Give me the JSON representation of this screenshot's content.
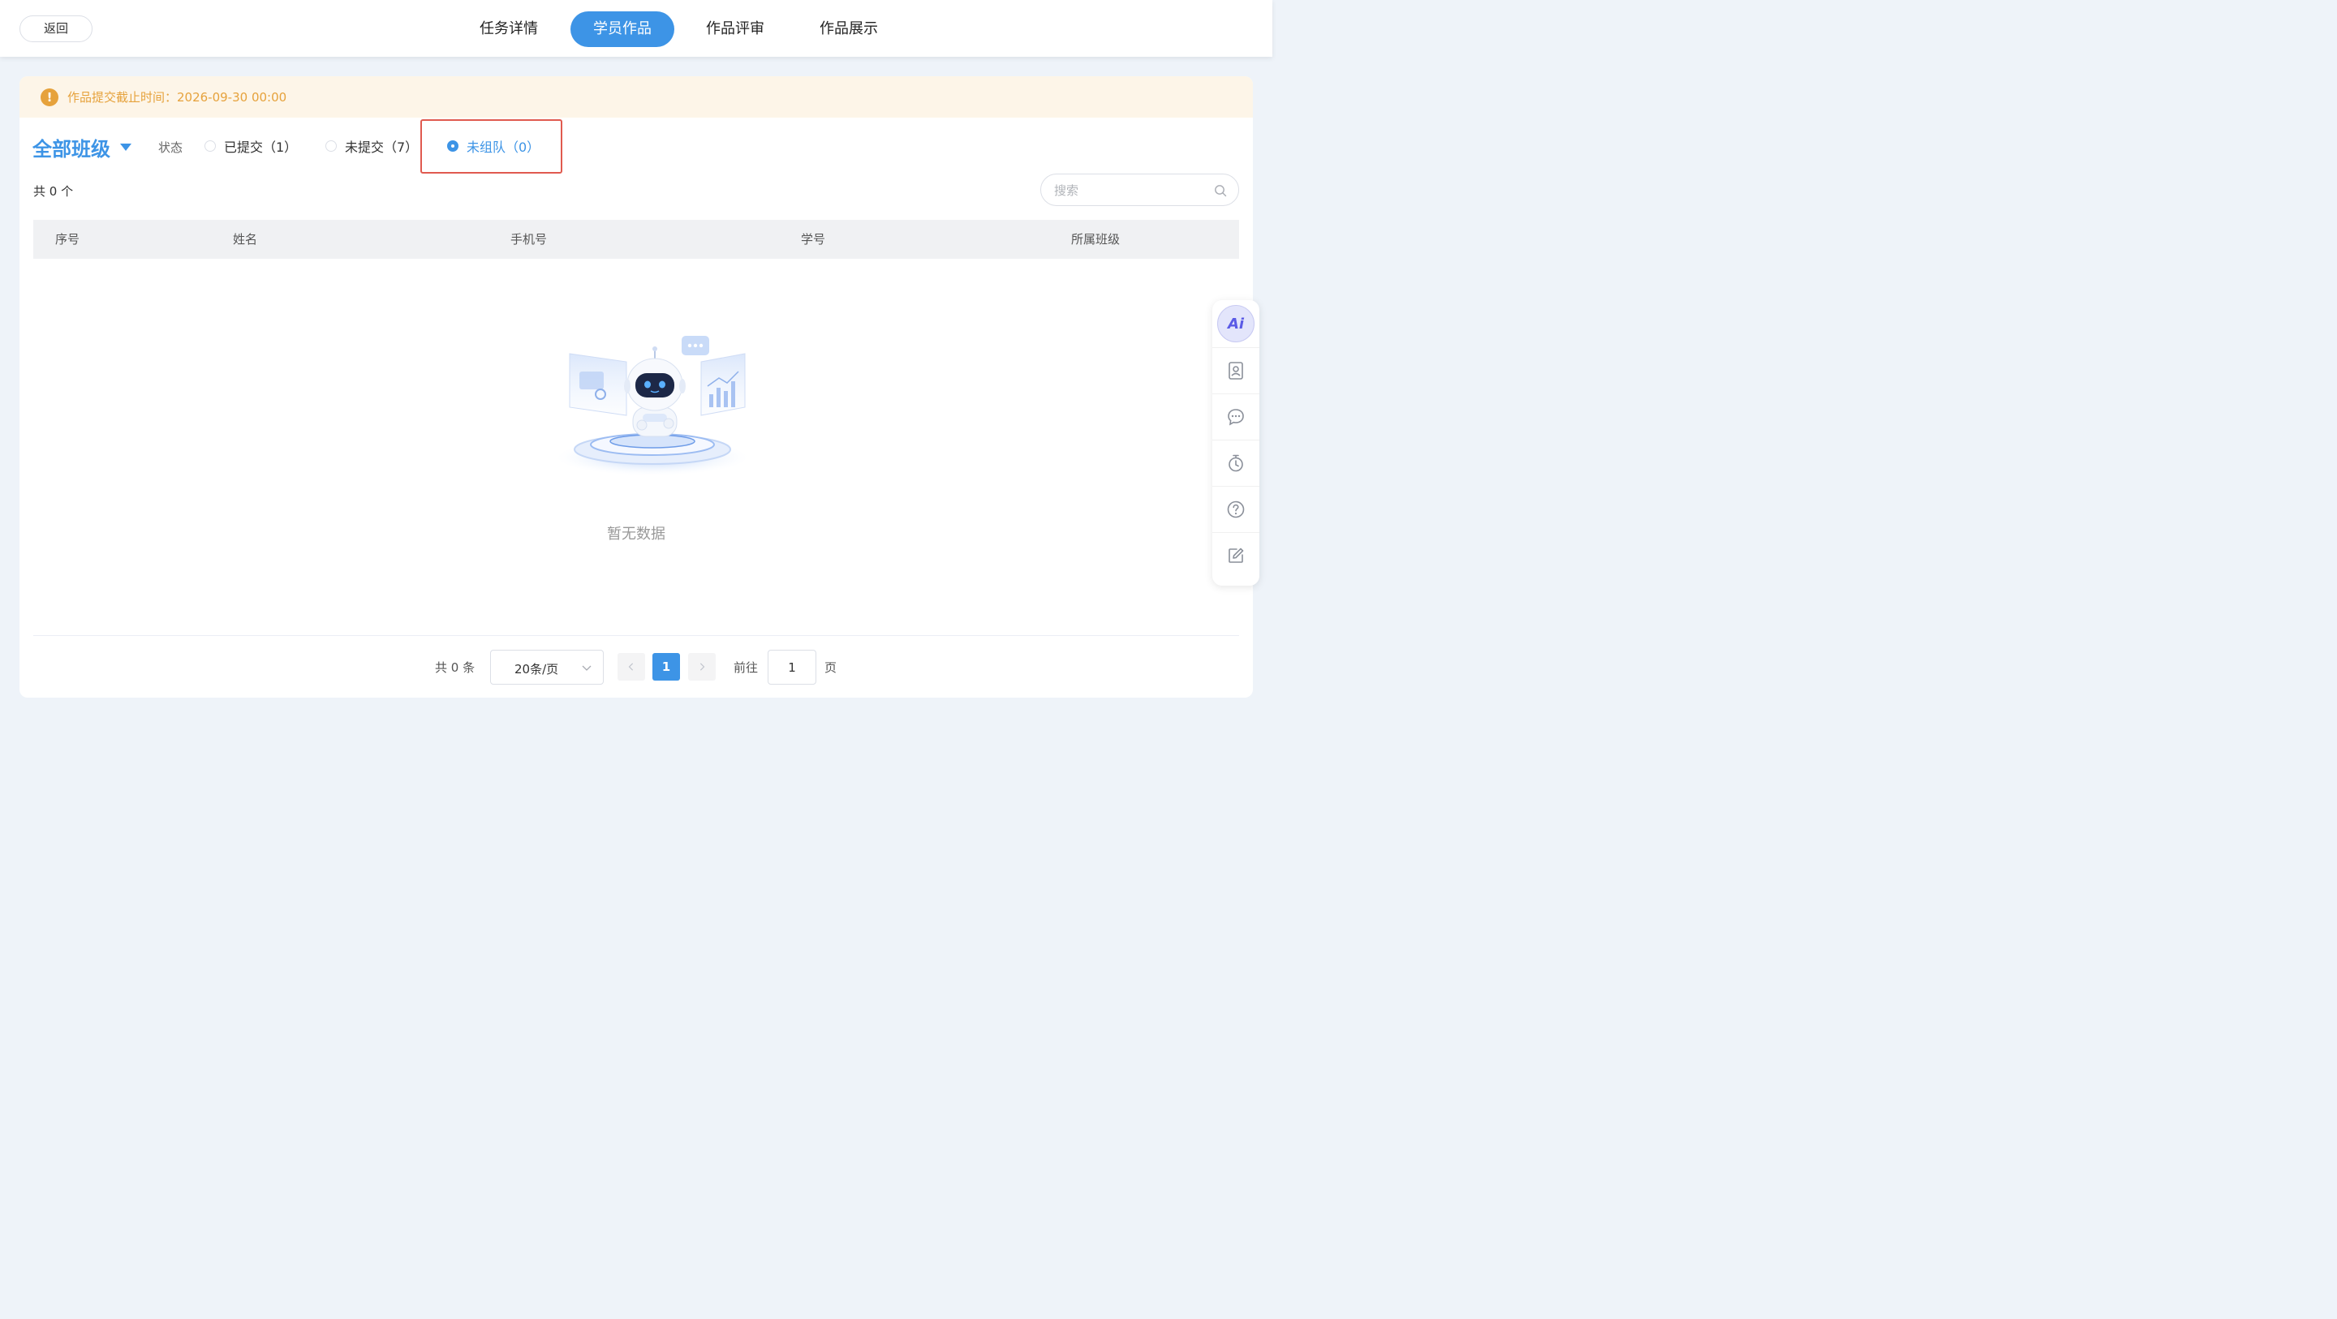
{
  "topbar": {
    "back_label": "返回",
    "tabs": [
      {
        "label": "任务详情",
        "active": false
      },
      {
        "label": "学员作品",
        "active": true
      },
      {
        "label": "作品评审",
        "active": false
      },
      {
        "label": "作品展示",
        "active": false
      }
    ]
  },
  "deadline": {
    "icon": "warning-icon",
    "text": "作品提交截止时间：2026-09-30 00:00",
    "color": "#e6a23c"
  },
  "filters": {
    "class_select": "全部班级",
    "status_label": "状态",
    "options": [
      {
        "label": "已提交（1）",
        "checked": false
      },
      {
        "label": "未提交（7）",
        "checked": false
      },
      {
        "label": "未组队（0）",
        "checked": true
      }
    ]
  },
  "list": {
    "total_text": "共 0 个",
    "search_placeholder": "搜索",
    "columns": [
      "序号",
      "姓名",
      "手机号",
      "学号",
      "所属班级"
    ],
    "empty_text": "暂无数据"
  },
  "pagination": {
    "total_text": "共 0 条",
    "page_size": "20条/页",
    "prev_icon": "chevron-left-icon",
    "current_page": "1",
    "next_icon": "chevron-right-icon",
    "goto_label": "前往",
    "goto_value": "1",
    "page_suffix": "页"
  },
  "side_tools": {
    "ai_label": "Ai",
    "icons": [
      "contact-card-icon",
      "chat-bubble-icon",
      "timer-icon",
      "help-icon",
      "edit-icon"
    ]
  },
  "colors": {
    "accent": "#3d94e6",
    "warning": "#e6a23c",
    "highlight": "#e05a4f"
  }
}
